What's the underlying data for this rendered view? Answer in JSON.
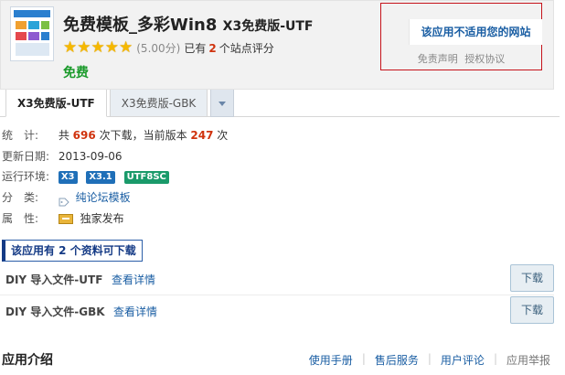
{
  "header": {
    "title": "免费模板_多彩Win8",
    "edition": "X3免费版-UTF",
    "stars": 5,
    "score": "(5.00分)",
    "rating_prefix": "已有",
    "rating_count": "2",
    "rating_suffix": "个站点评分",
    "price": "免费"
  },
  "notice": {
    "link": "该应用不适用您的网站",
    "disclaimer": "免责声明",
    "license": "授权协议"
  },
  "tabs": [
    {
      "label": "X3免费版-UTF",
      "active": true
    },
    {
      "label": "X3免费版-GBK",
      "active": false
    }
  ],
  "info": {
    "stats_label": "统　计:",
    "stats_prefix": "共",
    "downloads": "696",
    "stats_mid": "次下载，当前版本",
    "version_downloads": "247",
    "stats_suffix": "次",
    "updated_label": "更新日期:",
    "updated": "2013-09-06",
    "env_label": "运行环境:",
    "env": [
      "X3",
      "X3.1",
      "UTF8SC"
    ],
    "category_label": "分　类:",
    "category": "纯论坛模板",
    "attr_label": "属　性:",
    "attr": "独家发布"
  },
  "downloads": {
    "title": "该应用有 2 个资料可下载",
    "items": [
      {
        "name": "DIY 导入文件-UTF",
        "detail": "查看详情",
        "button": "下载"
      },
      {
        "name": "DIY 导入文件-GBK",
        "detail": "查看详情",
        "button": "下载"
      }
    ]
  },
  "intro": {
    "title": "应用介绍",
    "links": [
      "使用手册",
      "售后服务",
      "用户评论",
      "应用举报"
    ]
  },
  "colors": {
    "accent_red": "#d0330e",
    "link_blue": "#1a5ea3",
    "price_green": "#1a9a2a",
    "star": "#f5b800"
  },
  "icons": {
    "app": "app-thumbnail-icon",
    "star": "star-icon",
    "dropdown": "caret-down-icon",
    "tag": "tag-icon",
    "exclusive": "exclusive-badge-icon"
  }
}
